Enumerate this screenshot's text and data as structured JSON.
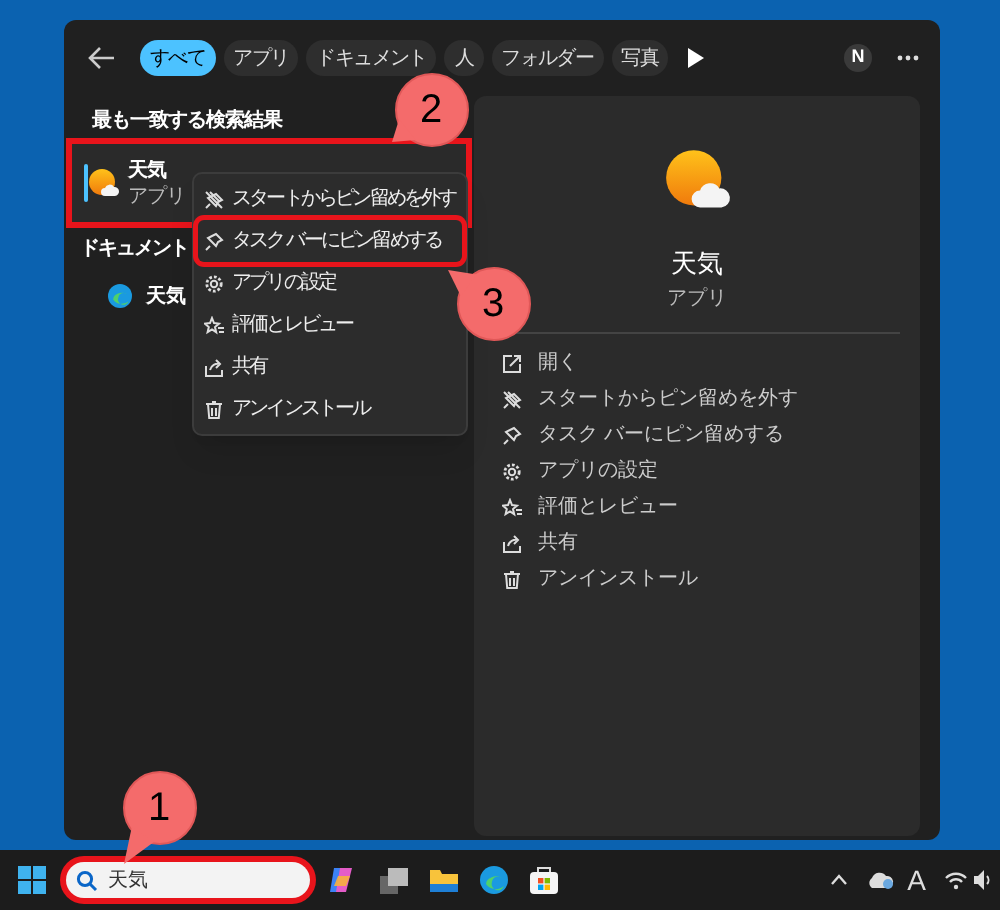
{
  "filter_tabs": [
    {
      "label": "すべて",
      "selected": true
    },
    {
      "label": "アプリ",
      "selected": false
    },
    {
      "label": "ドキュメント",
      "selected": false
    },
    {
      "label": "人",
      "selected": false
    },
    {
      "label": "フォルダー",
      "selected": false
    },
    {
      "label": "写真",
      "selected": false
    }
  ],
  "account_initial": "N",
  "best_match": {
    "heading": "最も一致する検索結果",
    "name": "天気",
    "type": "アプリ",
    "selected": true,
    "highlighted": true
  },
  "documents": {
    "heading": "ドキュメント",
    "items": [
      {
        "name": "天気"
      }
    ]
  },
  "context_menu": [
    {
      "label": "スタートからピン留めを外す",
      "kind": "unpin",
      "highlighted": false
    },
    {
      "label": "タスク バーにピン留めする",
      "kind": "pin",
      "highlighted": true
    },
    {
      "label": "アプリの設定",
      "kind": "settings",
      "highlighted": false
    },
    {
      "label": "評価とレビュー",
      "kind": "review",
      "highlighted": false
    },
    {
      "label": "共有",
      "kind": "share",
      "highlighted": false
    },
    {
      "label": "アンインストール",
      "kind": "uninstall",
      "highlighted": false
    }
  ],
  "preview": {
    "name": "天気",
    "type": "アプリ",
    "actions": [
      {
        "label": "開く",
        "kind": "open"
      },
      {
        "label": "スタートからピン留めを外す",
        "kind": "unpin"
      },
      {
        "label": "タスク バーにピン留めする",
        "kind": "pin"
      },
      {
        "label": "アプリの設定",
        "kind": "settings"
      },
      {
        "label": "評価とレビュー",
        "kind": "review"
      },
      {
        "label": "共有",
        "kind": "share"
      },
      {
        "label": "アンインストール",
        "kind": "uninstall"
      }
    ]
  },
  "taskbar": {
    "search": {
      "value": "天気",
      "highlighted": true
    },
    "input_indicator": "A"
  },
  "callouts": [
    {
      "number": "2"
    },
    {
      "number": "3"
    },
    {
      "number": "1"
    }
  ]
}
